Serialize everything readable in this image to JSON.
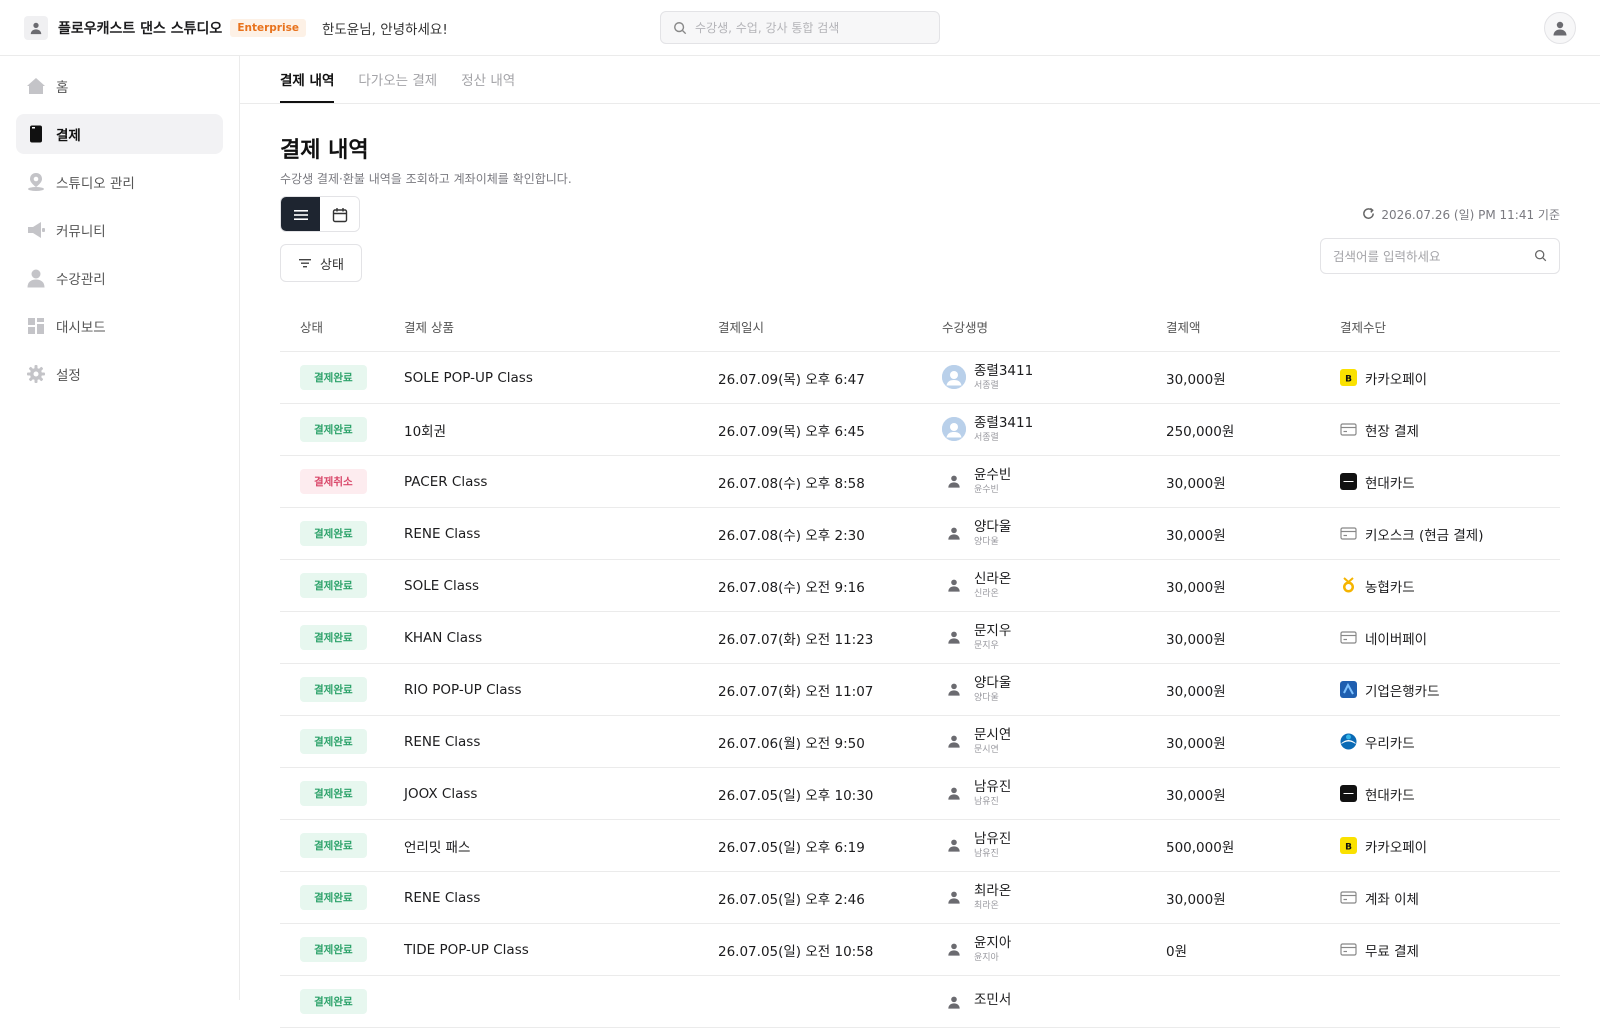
{
  "header": {
    "brand_name": "플로우캐스트 댄스 스튜디오",
    "plan_badge": "Enterprise",
    "greeting": "한도윤님, 안녕하세요!",
    "search_placeholder": "수강생, 수업, 강사 통합 검색"
  },
  "sidebar": {
    "items": [
      {
        "label": "홈",
        "icon": "home-icon",
        "active": false
      },
      {
        "label": "결제",
        "icon": "card-icon",
        "active": true
      },
      {
        "label": "스튜디오 관리",
        "icon": "location-icon",
        "active": false
      },
      {
        "label": "커뮤니티",
        "icon": "megaphone-icon",
        "active": false
      },
      {
        "label": "수강관리",
        "icon": "person-icon",
        "active": false
      },
      {
        "label": "대시보드",
        "icon": "dashboard-icon",
        "active": false
      },
      {
        "label": "설정",
        "icon": "gear-icon",
        "active": false
      }
    ]
  },
  "tabs": [
    {
      "label": "결제 내역",
      "active": true
    },
    {
      "label": "다가오는 결제",
      "active": false
    },
    {
      "label": "정산 내역",
      "active": false
    }
  ],
  "page": {
    "title": "결제 내역",
    "subtitle": "수강생 결제·환불 내역을 조회하고 계좌이체를 확인합니다.",
    "status_filter_label": "상태",
    "timestamp": "2026.07.26 (일) PM 11:41 기준",
    "table_search_placeholder": "검색어를 입력하세요"
  },
  "table": {
    "columns": [
      "상태",
      "결제 상품",
      "결제일시",
      "수강생명",
      "결제액",
      "결제수단"
    ],
    "rows": [
      {
        "status": "결제완료",
        "status_type": "ok",
        "product": "SOLE POP-UP Class",
        "datetime": "26.07.09(목) 오후 6:47",
        "student": "종렬3411",
        "student_sub": "서종렬",
        "avatar": "photo",
        "amount": "30,000원",
        "method": "카카오페이",
        "method_icon": "kakaopay-icon"
      },
      {
        "status": "결제완료",
        "status_type": "ok",
        "product": "10회권",
        "datetime": "26.07.09(목) 오후 6:45",
        "student": "종렬3411",
        "student_sub": "서종렬",
        "avatar": "photo",
        "amount": "250,000원",
        "method": "현장 결제",
        "method_icon": "card-outline-icon"
      },
      {
        "status": "결제취소",
        "status_type": "cancel",
        "product": "PACER Class",
        "datetime": "26.07.08(수) 오후 8:58",
        "student": "윤수빈",
        "student_sub": "윤수빈",
        "avatar": "plain",
        "amount": "30,000원",
        "method": "현대카드",
        "method_icon": "hyundaicard-icon"
      },
      {
        "status": "결제완료",
        "status_type": "ok",
        "product": "RENE Class",
        "datetime": "26.07.08(수) 오후 2:30",
        "student": "양다울",
        "student_sub": "양다울",
        "avatar": "plain",
        "amount": "30,000원",
        "method": "키오스크 (현금 결제)",
        "method_icon": "card-outline-icon"
      },
      {
        "status": "결제완료",
        "status_type": "ok",
        "product": "SOLE Class",
        "datetime": "26.07.08(수) 오전 9:16",
        "student": "신라온",
        "student_sub": "신라온",
        "avatar": "plain",
        "amount": "30,000원",
        "method": "농협카드",
        "method_icon": "nhcard-icon"
      },
      {
        "status": "결제완료",
        "status_type": "ok",
        "product": "KHAN Class",
        "datetime": "26.07.07(화) 오전 11:23",
        "student": "문지우",
        "student_sub": "문지우",
        "avatar": "plain",
        "amount": "30,000원",
        "method": "네이버페이",
        "method_icon": "card-outline-icon"
      },
      {
        "status": "결제완료",
        "status_type": "ok",
        "product": "RIO POP-UP Class",
        "datetime": "26.07.07(화) 오전 11:07",
        "student": "양다울",
        "student_sub": "양다울",
        "avatar": "plain",
        "amount": "30,000원",
        "method": "기업은행카드",
        "method_icon": "ibkcard-icon"
      },
      {
        "status": "결제완료",
        "status_type": "ok",
        "product": "RENE Class",
        "datetime": "26.07.06(월) 오전 9:50",
        "student": "문시연",
        "student_sub": "문시연",
        "avatar": "plain",
        "amount": "30,000원",
        "method": "우리카드",
        "method_icon": "wooricard-icon"
      },
      {
        "status": "결제완료",
        "status_type": "ok",
        "product": "JOOX Class",
        "datetime": "26.07.05(일) 오후 10:30",
        "student": "남유진",
        "student_sub": "남유진",
        "avatar": "plain",
        "amount": "30,000원",
        "method": "현대카드",
        "method_icon": "hyundaicard-icon"
      },
      {
        "status": "결제완료",
        "status_type": "ok",
        "product": "언리밋 패스",
        "datetime": "26.07.05(일) 오후 6:19",
        "student": "남유진",
        "student_sub": "남유진",
        "avatar": "plain",
        "amount": "500,000원",
        "method": "카카오페이",
        "method_icon": "kakaopay-icon"
      },
      {
        "status": "결제완료",
        "status_type": "ok",
        "product": "RENE Class",
        "datetime": "26.07.05(일) 오후 2:46",
        "student": "최라온",
        "student_sub": "최라온",
        "avatar": "plain",
        "amount": "30,000원",
        "method": "계좌 이체",
        "method_icon": "card-outline-icon"
      },
      {
        "status": "결제완료",
        "status_type": "ok",
        "product": "TIDE POP-UP Class",
        "datetime": "26.07.05(일) 오전 10:58",
        "student": "윤지아",
        "student_sub": "윤지아",
        "avatar": "plain",
        "amount": "0원",
        "method": "무료 결제",
        "method_icon": "card-outline-icon"
      },
      {
        "status": "결제완료",
        "status_type": "ok",
        "product": "",
        "datetime": "",
        "student": "조민서",
        "student_sub": "",
        "avatar": "plain",
        "amount": "",
        "method": "",
        "method_icon": "card-outline-icon"
      }
    ]
  }
}
